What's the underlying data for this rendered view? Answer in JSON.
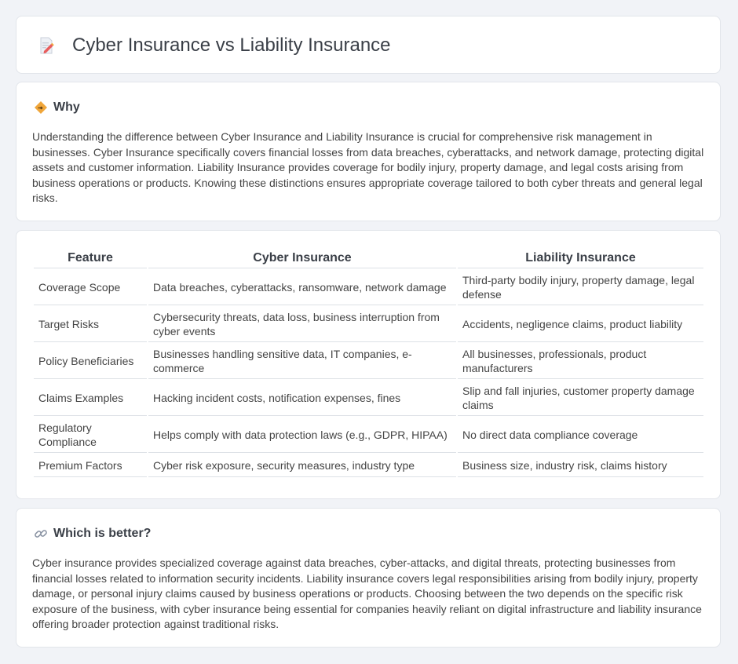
{
  "header": {
    "title": "Cyber Insurance vs Liability Insurance",
    "icon": "document-pen-icon"
  },
  "why": {
    "heading": "Why",
    "icon": "diamond-sign-icon",
    "text": "Understanding the difference between Cyber Insurance and Liability Insurance is crucial for comprehensive risk management in businesses. Cyber Insurance specifically covers financial losses from data breaches, cyberattacks, and network damage, protecting digital assets and customer information. Liability Insurance provides coverage for bodily injury, property damage, and legal costs arising from business operations or products. Knowing these distinctions ensures appropriate coverage tailored to both cyber threats and general legal risks."
  },
  "comparison": {
    "headers": [
      "Feature",
      "Cyber Insurance",
      "Liability Insurance"
    ],
    "rows": [
      [
        "Coverage Scope",
        "Data breaches, cyberattacks, ransomware, network damage",
        "Third-party bodily injury, property damage, legal defense"
      ],
      [
        "Target Risks",
        "Cybersecurity threats, data loss, business interruption from cyber events",
        "Accidents, negligence claims, product liability"
      ],
      [
        "Policy Beneficiaries",
        "Businesses handling sensitive data, IT companies, e-commerce",
        "All businesses, professionals, product manufacturers"
      ],
      [
        "Claims Examples",
        "Hacking incident costs, notification expenses, fines",
        "Slip and fall injuries, customer property damage claims"
      ],
      [
        "Regulatory Compliance",
        "Helps comply with data protection laws (e.g., GDPR, HIPAA)",
        "No direct data compliance coverage"
      ],
      [
        "Premium Factors",
        "Cyber risk exposure, security measures, industry type",
        "Business size, industry risk, claims history"
      ]
    ]
  },
  "better": {
    "heading": "Which is better?",
    "icon": "link-icon",
    "text": "Cyber insurance provides specialized coverage against data breaches, cyber-attacks, and digital threats, protecting businesses from financial losses related to information security incidents. Liability insurance covers legal responsibilities arising from bodily injury, property damage, or personal injury claims caused by business operations or products. Choosing between the two depends on the specific risk exposure of the business, with cyber insurance being essential for companies heavily reliant on digital infrastructure and liability insurance offering broader protection against traditional risks."
  },
  "colors": {
    "background": "#f1f3f7",
    "card": "#ffffff",
    "border": "#e2e5ea",
    "accent": "#f0a63a"
  }
}
